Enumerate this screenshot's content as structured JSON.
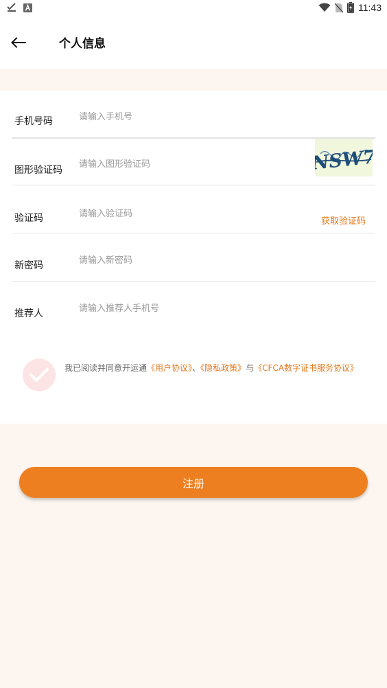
{
  "status_bar": {
    "time": "11:43"
  },
  "header": {
    "title": "个人信息"
  },
  "form": {
    "phone": {
      "label": "手机号码",
      "placeholder": "请输入手机号",
      "value": ""
    },
    "captcha": {
      "label": "图形验证码",
      "placeholder": "请输入图形验证码",
      "value": "",
      "image_text": "NSW7"
    },
    "sms_code": {
      "label": "验证码",
      "placeholder": "请输入验证码",
      "value": "",
      "get_code_label": "获取验证码"
    },
    "new_password": {
      "label": "新密码",
      "placeholder": "请输入新密码",
      "value": ""
    },
    "referrer": {
      "label": "推荐人",
      "placeholder": "请输入推荐人手机号",
      "value": ""
    }
  },
  "agreement": {
    "prefix": "我已阅读并同意开运通",
    "user_agreement": "《用户协议》",
    "separator": "、",
    "privacy_policy": "《隐私政策》",
    "conjunction": "与",
    "cfca_agreement": "《CFCA数字证书服务协议》",
    "checked": false
  },
  "actions": {
    "register_label": "注册"
  },
  "colors": {
    "accent": "#ee7f20",
    "link": "#e07a1f",
    "background": "#fdf5ef",
    "check_bg": "#fde4e4"
  }
}
